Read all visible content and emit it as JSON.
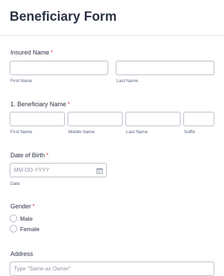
{
  "form": {
    "title": "Beneficiary Form"
  },
  "insured_name": {
    "label": "Insured Name",
    "required_mark": "*",
    "sublabels": [
      "First Name",
      "Last Name"
    ]
  },
  "beneficiary_name": {
    "label": "1. Beneficiary Name",
    "required_mark": "*",
    "sublabels": [
      "First Name",
      "Middle Name",
      "Last Name",
      "Suffix"
    ]
  },
  "date_of_birth": {
    "label": "Date of Birth",
    "required_mark": "*",
    "placeholder": "MM-DD-YYYY",
    "sublabel": "Date",
    "icon": "calendar-icon"
  },
  "gender": {
    "label": "Gender",
    "required_mark": "*",
    "options": [
      "Male",
      "Female"
    ]
  },
  "address": {
    "label": "Address",
    "placeholder": "Type \"Same as Owner\""
  }
}
